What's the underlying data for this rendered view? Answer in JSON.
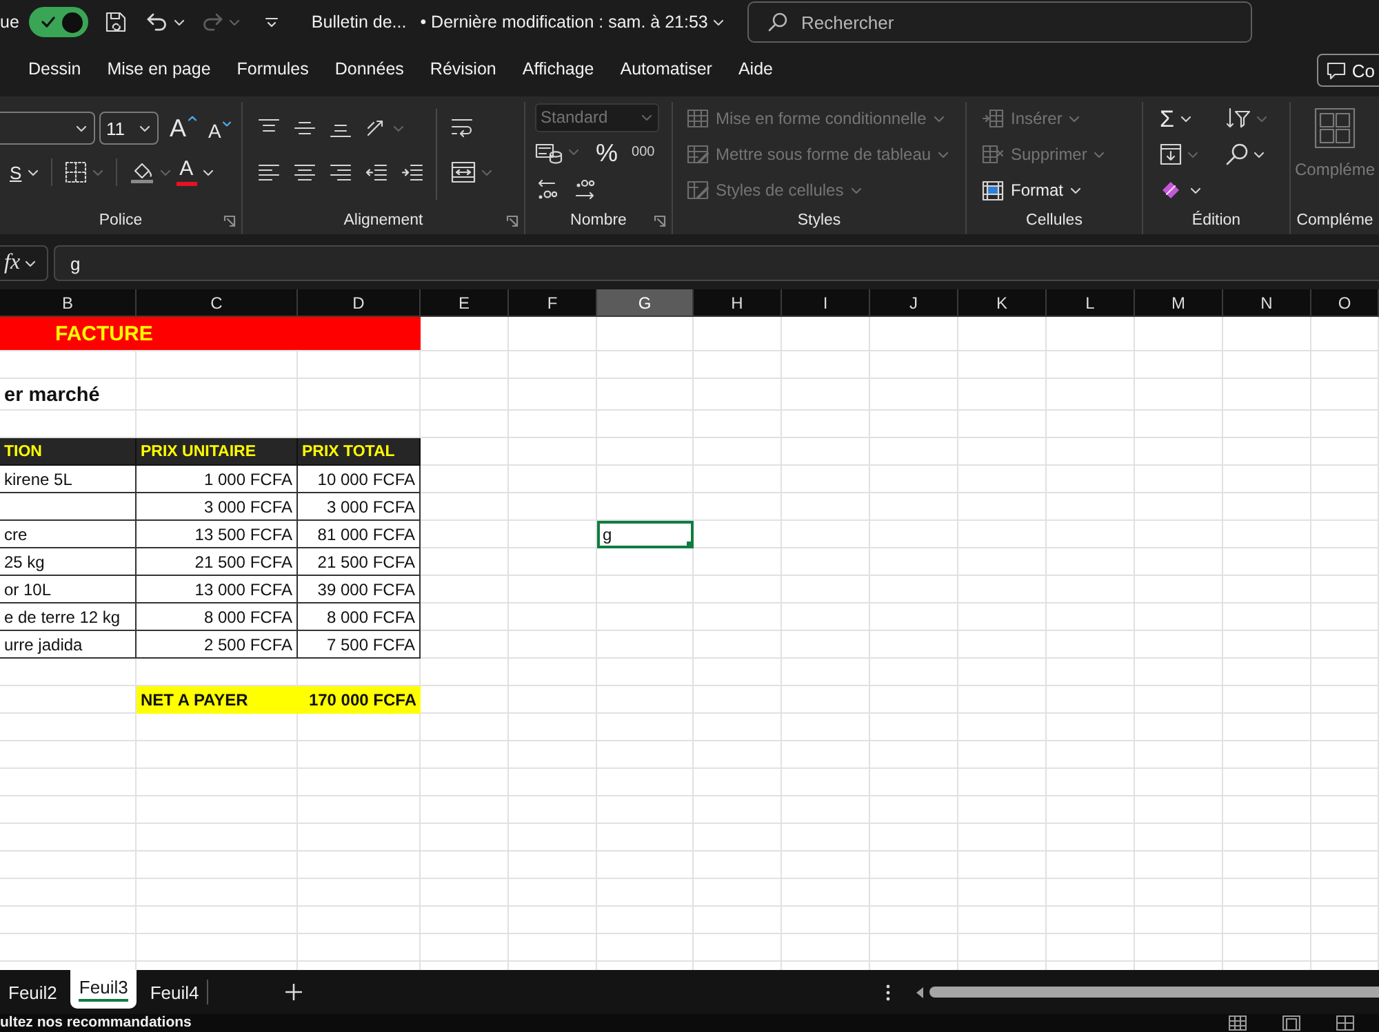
{
  "title_bar": {
    "autosave": {
      "label": "ue",
      "on": true
    },
    "quick_access": [
      {
        "kind": "save",
        "disabled": false
      },
      {
        "kind": "undo",
        "disabled": false
      },
      {
        "kind": "redo",
        "disabled": true
      },
      {
        "kind": "customize",
        "disabled": false
      }
    ],
    "file_name": "Bulletin de...",
    "modified": "• Dernière modification : sam. à 21:53",
    "search": {
      "placeholder": "Rechercher"
    }
  },
  "menu_tabs": [
    {
      "label": "Dessin",
      "selected": false
    },
    {
      "label": "Mise en page",
      "selected": false
    },
    {
      "label": "Formules",
      "selected": false
    },
    {
      "label": "Données",
      "selected": false
    },
    {
      "label": "Révision",
      "selected": false
    },
    {
      "label": "Affichage",
      "selected": false
    },
    {
      "label": "Automatiser",
      "selected": false
    },
    {
      "label": "Aide",
      "selected": false
    }
  ],
  "comments_button": {
    "label": "Co"
  },
  "ribbon": {
    "police": {
      "label": "Police",
      "font_size": "11",
      "grow": "A",
      "shrink": "A",
      "underline": "S",
      "font_color": "A"
    },
    "alignement": {
      "label": "Alignement"
    },
    "nombre": {
      "label": "Nombre",
      "format": {
        "value": "Standard",
        "disabled": true
      },
      "percent": "%",
      "thousands": "000"
    },
    "styles": {
      "label": "Styles",
      "commands": [
        {
          "kind": "conditional",
          "label": "Mise en forme conditionnelle",
          "disabled": true
        },
        {
          "kind": "table",
          "label": "Mettre sous forme de tableau",
          "disabled": true
        },
        {
          "kind": "cell_styles",
          "label": "Styles de cellules",
          "disabled": true
        }
      ]
    },
    "cellules": {
      "label": "Cellules",
      "commands": [
        {
          "kind": "insert",
          "label": "Insérer",
          "disabled": true
        },
        {
          "kind": "delete",
          "label": "Supprimer",
          "disabled": true
        },
        {
          "kind": "format",
          "label": "Format",
          "disabled": false
        }
      ]
    },
    "edition": {
      "label": "Édition",
      "sum": "Σ"
    },
    "complements": {
      "label": "Compléme",
      "command": {
        "label": "Compléme",
        "disabled": true
      }
    }
  },
  "formula_bar": {
    "function_label": "fx",
    "value": "g"
  },
  "sheet": {
    "columns": [
      {
        "label": "B",
        "selected": false
      },
      {
        "label": "C",
        "selected": false
      },
      {
        "label": "D",
        "selected": false
      },
      {
        "label": "E",
        "selected": false
      },
      {
        "label": "F",
        "selected": false
      },
      {
        "label": "G",
        "selected": true
      },
      {
        "label": "H",
        "selected": false
      },
      {
        "label": "I",
        "selected": false
      },
      {
        "label": "J",
        "selected": false
      },
      {
        "label": "K",
        "selected": false
      },
      {
        "label": "L",
        "selected": false
      },
      {
        "label": "M",
        "selected": false
      },
      {
        "label": "N",
        "selected": false
      },
      {
        "label": "O",
        "selected": false
      }
    ],
    "rows": [
      {
        "kind": "banner",
        "b": "FACTURE"
      },
      {
        "kind": "blank"
      },
      {
        "kind": "heading",
        "b": "er marché"
      },
      {
        "kind": "blank"
      },
      {
        "kind": "table_header",
        "b": "TION",
        "c": "PRIX UNITAIRE",
        "d": "PRIX TOTAL"
      },
      {
        "kind": "item",
        "b": "kirene 5L",
        "c": "1 000 FCFA",
        "d": "10 000 FCFA"
      },
      {
        "kind": "item",
        "c": "3 000 FCFA",
        "d": "3 000 FCFA"
      },
      {
        "kind": "item",
        "b": "cre",
        "c": "13 500 FCFA",
        "d": "81 000 FCFA",
        "active_value": "g"
      },
      {
        "kind": "item",
        "b": "25 kg",
        "c": "21 500 FCFA",
        "d": "21 500 FCFA"
      },
      {
        "kind": "item",
        "b": "or 10L",
        "c": "13 000 FCFA",
        "d": "39 000 FCFA"
      },
      {
        "kind": "item",
        "b": "e de terre 12 kg",
        "c": "8 000 FCFA",
        "d": "8 000 FCFA"
      },
      {
        "kind": "item",
        "b": "urre jadida",
        "c": "2 500 FCFA",
        "d": "7 500 FCFA"
      },
      {
        "kind": "blank"
      },
      {
        "kind": "total",
        "c": "NET A PAYER",
        "d": "170 000 FCFA"
      }
    ]
  },
  "sheet_tabs": [
    {
      "label": "Feuil2",
      "selected": false
    },
    {
      "label": "Feuil3",
      "selected": true
    },
    {
      "label": "Feuil4",
      "selected": false
    }
  ],
  "status_bar": {
    "message": "ultez nos recommandations"
  }
}
